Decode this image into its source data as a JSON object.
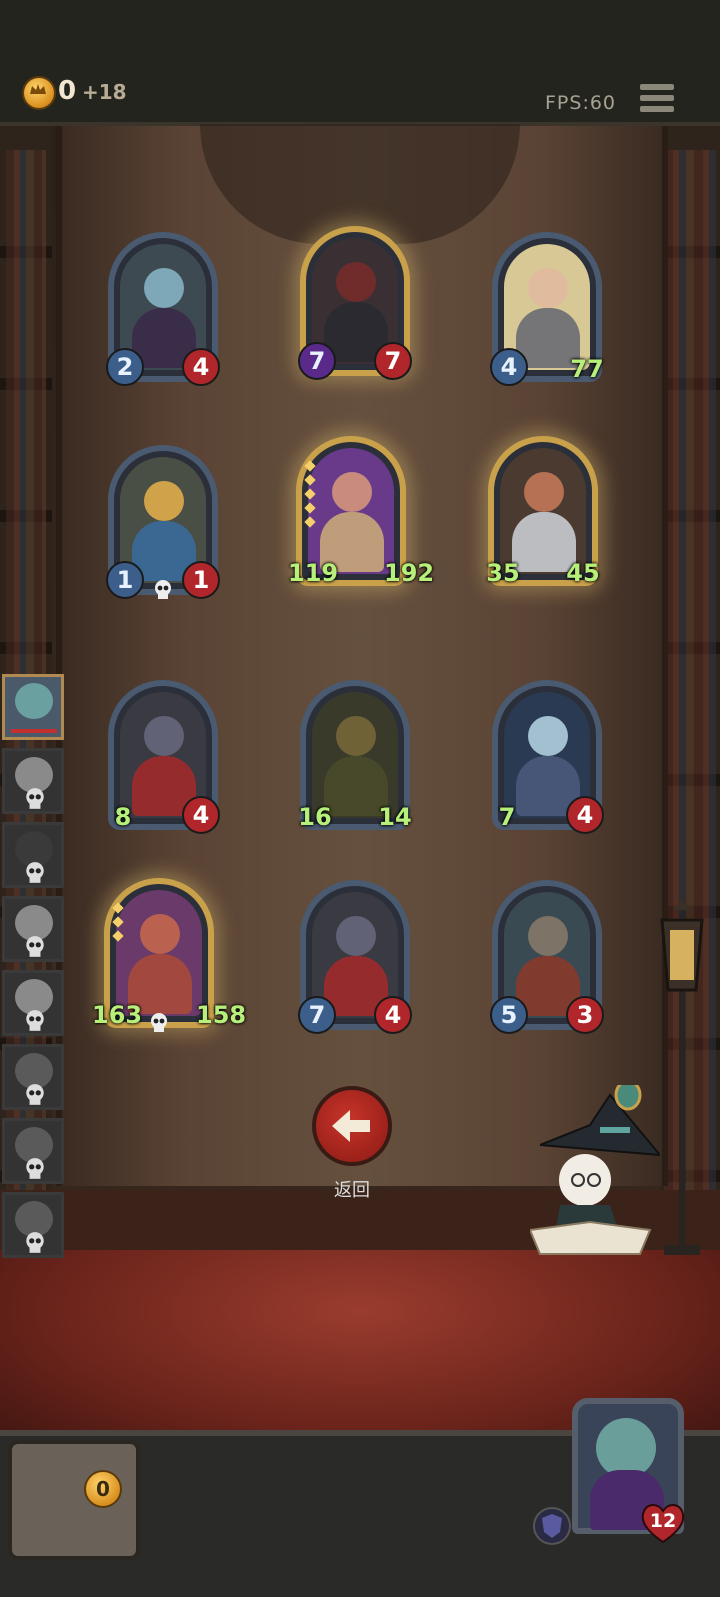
{
  "header": {
    "gold": "0",
    "gold_income": "+18",
    "fps": "FPS:60"
  },
  "board": {
    "cards": [
      {
        "attack": "2",
        "health": "4"
      },
      {
        "attack": "7",
        "health": "7"
      },
      {
        "attack": "4",
        "health": "77"
      },
      {
        "attack": "1",
        "health": "1"
      },
      {
        "attack": "119",
        "health": "192"
      },
      {
        "attack": "35",
        "health": "45"
      },
      {
        "attack": "8",
        "health": "4"
      },
      {
        "attack": "16",
        "health": "14"
      },
      {
        "attack": "7",
        "health": "4"
      },
      {
        "attack": "163",
        "health": "158"
      },
      {
        "attack": "7",
        "health": "4"
      },
      {
        "attack": "5",
        "health": "3"
      }
    ]
  },
  "back_button": {
    "label": "返回"
  },
  "bottom": {
    "chest_coins": "0",
    "hero_health": "12"
  },
  "colors": {
    "atk": "#3c5e8a",
    "hp": "#b0262a",
    "buff": "#b6f07a",
    "gold_frame": "#c9a14a"
  }
}
